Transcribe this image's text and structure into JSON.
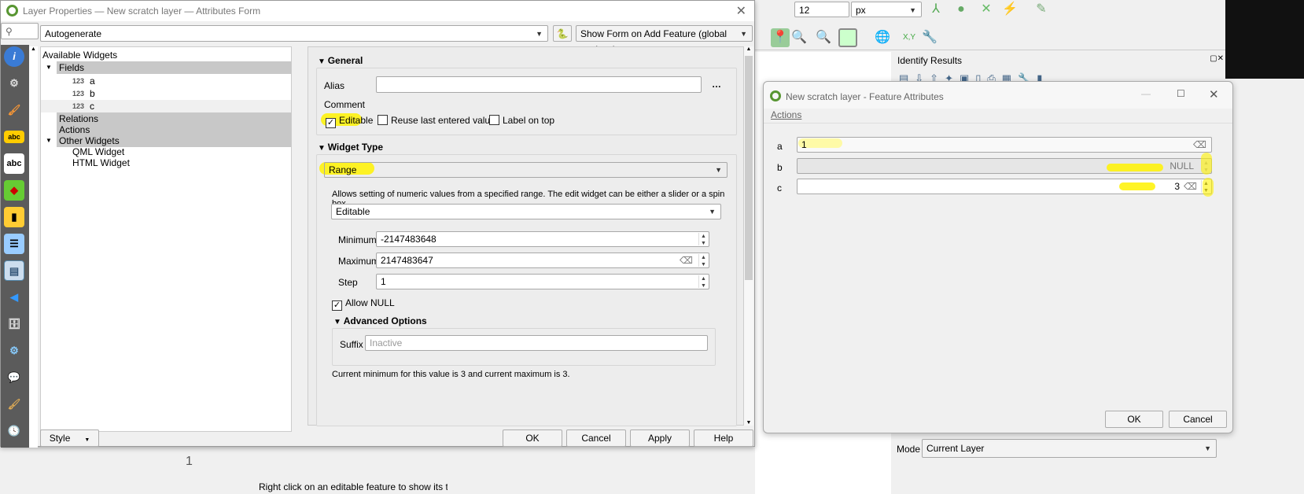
{
  "colors": {
    "highlight": "#fff200",
    "sidebar": "#5b5b5b",
    "qgis_green": "#589632"
  },
  "background": {
    "toolbar": {
      "size_value": "12",
      "unit": "px"
    },
    "identify_panel": {
      "title": "Identify Results",
      "mode_label": "Mode",
      "mode_value": "Current Layer"
    },
    "bottom_hint": "Right click on an editable feature to show its table of",
    "row_number": "1"
  },
  "layer_props": {
    "title": "Layer Properties — New scratch layer — Attributes Form",
    "layout_combo": "Autogenerate",
    "form_mode_combo": "Show Form on Add Feature (global settings)",
    "tree": {
      "header": "Available Widgets",
      "fields_label": "Fields",
      "fields": [
        {
          "type": "123",
          "name": "a"
        },
        {
          "type": "123",
          "name": "b"
        },
        {
          "type": "123",
          "name": "c"
        }
      ],
      "relations": "Relations",
      "actions": "Actions",
      "other": "Other Widgets",
      "other_items": [
        "QML Widget",
        "HTML Widget"
      ]
    },
    "general": {
      "title": "General",
      "alias_label": "Alias",
      "alias_value": "",
      "comment_label": "Comment",
      "editable": "Editable",
      "reuse": "Reuse last entered value",
      "label_on_top": "Label on top",
      "expr_btn": "…"
    },
    "widget_type": {
      "title": "Widget Type",
      "type": "Range",
      "description": "Allows setting of numeric values from a specified range. The edit widget can be either a slider or a spin box.",
      "mode": "Editable",
      "minimum_label": "Minimum",
      "minimum": "-2147483648",
      "maximum_label": "Maximum",
      "maximum": "2147483647",
      "step_label": "Step",
      "step": "1",
      "allow_null": "Allow NULL",
      "advanced": "Advanced Options",
      "suffix_label": "Suffix",
      "suffix_placeholder": "Inactive",
      "status": "Current minimum for this value is 3 and current maximum is 3."
    },
    "buttons": {
      "style": "Style",
      "ok": "OK",
      "cancel": "Cancel",
      "apply": "Apply",
      "help": "Help"
    }
  },
  "feature_dialog": {
    "title": "New scratch layer - Feature Attributes",
    "menu": "Actions",
    "fields": [
      {
        "label": "a",
        "value": "1"
      },
      {
        "label": "b",
        "value": "NULL"
      },
      {
        "label": "c",
        "value": "3"
      }
    ],
    "ok": "OK",
    "cancel": "Cancel"
  }
}
